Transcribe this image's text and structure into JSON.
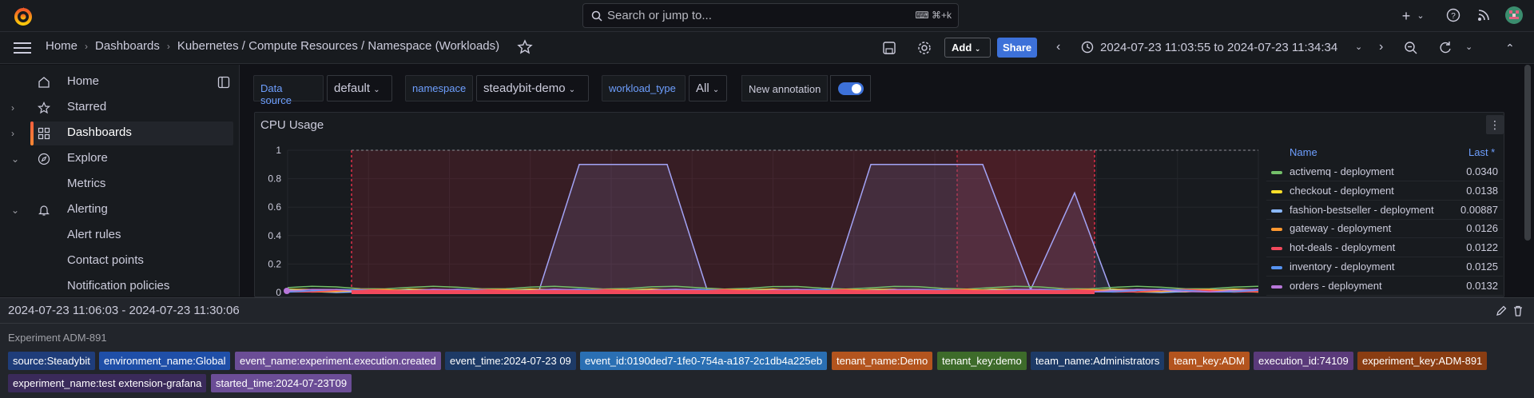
{
  "search": {
    "placeholder": "Search or jump to...",
    "shortcut": "⌘+k"
  },
  "breadcrumb": [
    "Home",
    "Dashboards",
    "Kubernetes / Compute Resources / Namespace (Workloads)"
  ],
  "toolbar": {
    "add_label": "Add",
    "share_label": "Share",
    "time_range": "2024-07-23 11:03:55 to 2024-07-23 11:34:34"
  },
  "sidebar": {
    "items": [
      {
        "label": "Home",
        "icon": "home-icon"
      },
      {
        "label": "Starred",
        "icon": "star-icon"
      },
      {
        "label": "Dashboards",
        "icon": "grid-icon"
      },
      {
        "label": "Explore",
        "icon": "compass-icon"
      },
      {
        "label": "Metrics",
        "icon": ""
      },
      {
        "label": "Alerting",
        "icon": "bell-icon"
      },
      {
        "label": "Alert rules",
        "icon": ""
      },
      {
        "label": "Contact points",
        "icon": ""
      },
      {
        "label": "Notification policies",
        "icon": ""
      }
    ]
  },
  "variables": {
    "datasource_label": "Data source",
    "datasource_value": "default",
    "namespace_label": "namespace",
    "namespace_value": "steadybit-demo",
    "workload_label": "workload_type",
    "workload_value": "All",
    "annotation_label": "New annotation"
  },
  "panel": {
    "title": "CPU Usage",
    "legend_name_header": "Name",
    "legend_last_header": "Last *"
  },
  "chart_data": {
    "type": "line",
    "title": "CPU Usage",
    "xlabel": "",
    "ylabel": "",
    "ylim": [
      0,
      1
    ],
    "yticks": [
      "1",
      "0.8",
      "0.6",
      "0.4",
      "0.2",
      "0"
    ],
    "grid": true,
    "legend": "right",
    "series": [
      {
        "name": "activemq - deployment",
        "last": "0.0340",
        "color": "#73bf69"
      },
      {
        "name": "checkout - deployment",
        "last": "0.0138",
        "color": "#fade2a"
      },
      {
        "name": "fashion-bestseller - deployment",
        "last": "0.00887",
        "color": "#8ab8ff"
      },
      {
        "name": "gateway - deployment",
        "last": "0.0126",
        "color": "#ff9830"
      },
      {
        "name": "hot-deals - deployment",
        "last": "0.0122",
        "color": "#f2495c"
      },
      {
        "name": "inventory - deployment",
        "last": "0.0125",
        "color": "#5794f2"
      },
      {
        "name": "orders - deployment",
        "last": "0.0132",
        "color": "#b877d9"
      }
    ],
    "spike_series": {
      "color": "#a3a3f5",
      "values": [
        0.02,
        0.02,
        0.9,
        0.9,
        0.02,
        0.02,
        0.9,
        0.9,
        0.02,
        0.7,
        0.02,
        0.02
      ]
    }
  },
  "tooltip": {
    "range": "2024-07-23 11:06:03 - 2024-07-23 11:30:06",
    "title": "Experiment ADM-891",
    "tags": [
      {
        "text": "source:Steadybit",
        "color": "#1f3d7a"
      },
      {
        "text": "environment_name:Global",
        "color": "#1f4fa8"
      },
      {
        "text": "event_name:experiment.execution.created",
        "color": "#6b4d96"
      },
      {
        "text": "event_time:2024-07-23 09",
        "color": "#1d3a66"
      },
      {
        "text": "event_id:0190ded7-1fe0-754a-a187-2c1db4a225eb",
        "color": "#2a6fb3"
      },
      {
        "text": "tenant_name:Demo",
        "color": "#b3541e"
      },
      {
        "text": "tenant_key:demo",
        "color": "#3d6b2a"
      },
      {
        "text": "team_name:Administrators",
        "color": "#1d3a66"
      },
      {
        "text": "team_key:ADM",
        "color": "#b3541e"
      },
      {
        "text": "execution_id:74109",
        "color": "#5a3a7a"
      },
      {
        "text": "experiment_key:ADM-891",
        "color": "#8a3d12"
      },
      {
        "text": "experiment_name:test extension-grafana",
        "color": "#3a2a5a"
      },
      {
        "text": "started_time:2024-07-23T09",
        "color": "#6b4d96"
      }
    ]
  }
}
